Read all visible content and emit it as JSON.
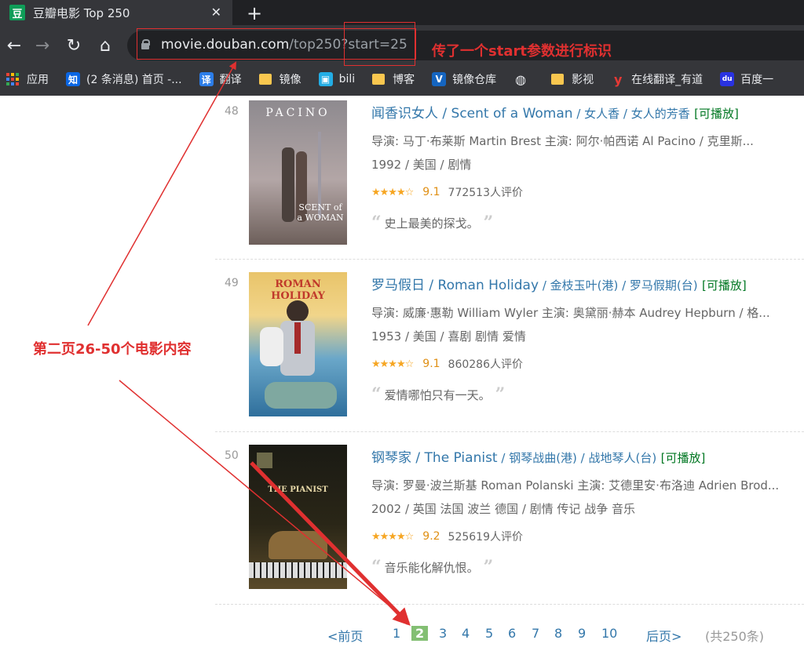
{
  "browser": {
    "tab_favicon": "豆",
    "tab_title": "豆瓣电影 Top 250",
    "tab_close": "✕",
    "new_tab": "+",
    "url_host": "movie.douban.com",
    "url_path": "/top250?start=25"
  },
  "bookmarks": [
    {
      "label": "应用",
      "icon": "apps-grid-icon"
    },
    {
      "label": "(2 条消息) 首页 -...",
      "icon": "zhihu-icon",
      "glyph": "知",
      "color": "#0a66e4"
    },
    {
      "label": "翻译",
      "icon": "translate-icon",
      "glyph": "译",
      "color": "#2b7de9"
    },
    {
      "label": "镜像",
      "icon": "folder-icon"
    },
    {
      "label": "bili",
      "icon": "bilibili-icon",
      "glyph": "▣",
      "color": "#23ade5"
    },
    {
      "label": "博客",
      "icon": "folder-icon"
    },
    {
      "label": "镜像仓库",
      "icon": "v-icon",
      "glyph": "V",
      "color": "#1565c0"
    },
    {
      "label": "",
      "icon": "globe-icon",
      "glyph": "◍",
      "color": "#9aa0a6"
    },
    {
      "label": "影视",
      "icon": "folder-icon"
    },
    {
      "label": "在线翻译_有道",
      "icon": "youdao-icon",
      "glyph": "y",
      "color": "#d32f2f"
    },
    {
      "label": "百度一",
      "icon": "baidu-icon",
      "glyph": "du",
      "color": "#2932e1"
    }
  ],
  "movies": [
    {
      "rank": "48",
      "title": "闻香识女人",
      "title_en": " / Scent of a Woman",
      "other_titles": " / 女人香 / 女人的芳香",
      "playable": "[可播放]",
      "crew": "导演: 马丁·布莱斯 Martin Brest   主演: 阿尔·帕西诺 Al Pacino / 克里斯...",
      "meta": "1992 / 美国 / 剧情",
      "score": "9.1",
      "votes": "772513人评价",
      "quote": "史上最美的探戈。",
      "stars": 4.5,
      "poster": {
        "top_text": "PACINO",
        "bottom_text": "SCENT of a WOMAN"
      }
    },
    {
      "rank": "49",
      "title": "罗马假日",
      "title_en": " / Roman Holiday",
      "other_titles": " / 金枝玉叶(港) / 罗马假期(台)",
      "playable": "[可播放]",
      "crew": "导演: 威廉·惠勒 William Wyler   主演: 奥黛丽·赫本 Audrey Hepburn / 格...",
      "meta": "1953 / 美国 / 喜剧 剧情 爱情",
      "score": "9.1",
      "votes": "860286人评价",
      "quote": "爱情哪怕只有一天。",
      "stars": 4.5,
      "poster": {
        "top_text": "ROMAN HOLIDAY"
      }
    },
    {
      "rank": "50",
      "title": "钢琴家",
      "title_en": " / The Pianist",
      "other_titles": " / 钢琴战曲(港) / 战地琴人(台)",
      "playable": "[可播放]",
      "crew": "导演: 罗曼·波兰斯基 Roman Polanski   主演: 艾德里安·布洛迪 Adrien Brod...",
      "meta": "2002 / 英国 法国 波兰 德国 / 剧情 传记 战争 音乐",
      "score": "9.2",
      "votes": "525619人评价",
      "quote": "音乐能化解仇恨。",
      "stars": 4.5,
      "poster": {
        "top_text": "THE PIANIST"
      }
    }
  ],
  "pager": {
    "prev": "<前页",
    "pages": [
      "1",
      "2",
      "3",
      "4",
      "5",
      "6",
      "7",
      "8",
      "9",
      "10"
    ],
    "current": "2",
    "next": "后页>",
    "count": "(共250条)"
  },
  "annotations": {
    "url_note": "传了一个start参数进行标识",
    "page_note": "第二页26-50个电影内容"
  },
  "colors": {
    "link": "#3377aa",
    "playable": "#007722",
    "star": "#f6a623",
    "annotation": "#e03030",
    "pager_current": "#83bf73"
  }
}
